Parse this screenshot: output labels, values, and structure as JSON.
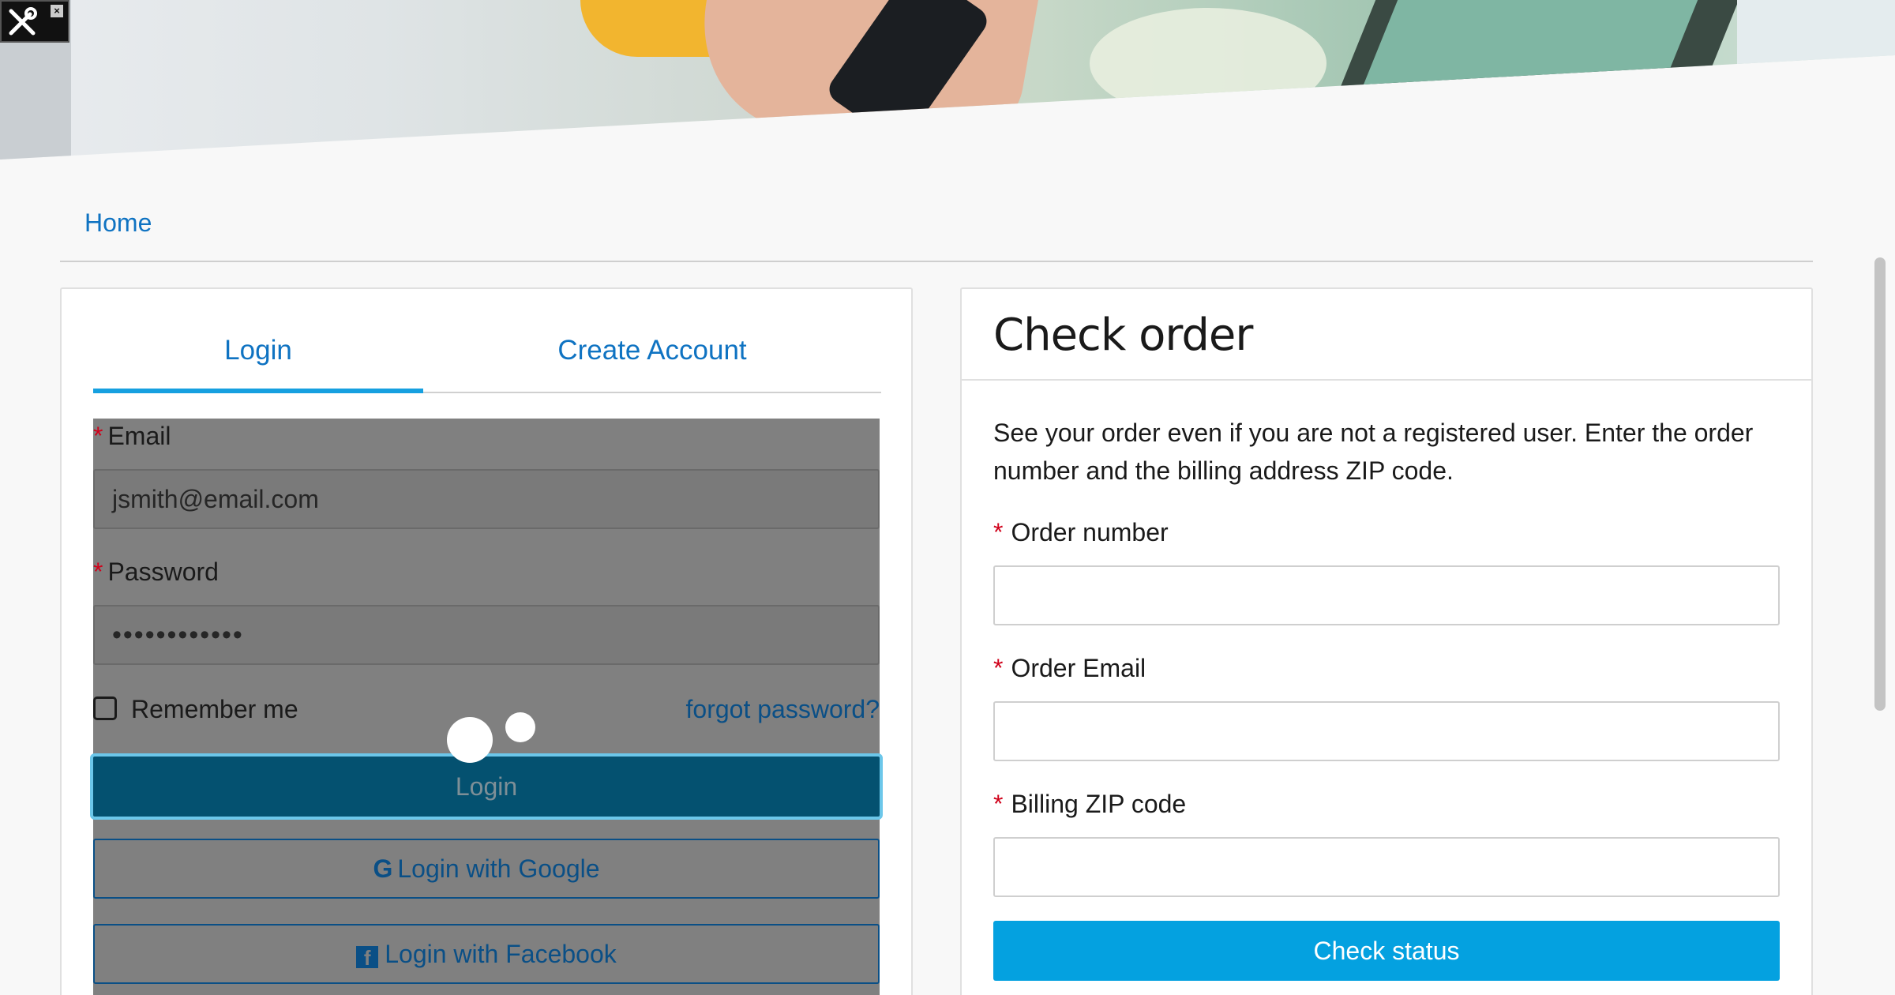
{
  "toolbar_widget": {
    "tools_icon": "tools-icon",
    "close_glyph": "×"
  },
  "breadcrumb": {
    "home": "Home"
  },
  "login_panel": {
    "tabs": {
      "login": "Login",
      "create_account": "Create Account"
    },
    "email": {
      "label": "Email",
      "required_mark": "*",
      "value": "jsmith@email.com"
    },
    "password": {
      "label": "Password",
      "required_mark": "*",
      "value": "••••••••••••"
    },
    "remember_me": "Remember me",
    "forgot_password": "forgot password?",
    "login_button": "Login",
    "google_button": "Login with Google",
    "google_icon_glyph": "G",
    "facebook_button": "Login with Facebook",
    "facebook_icon_glyph": "f"
  },
  "check_order_panel": {
    "title": "Check order",
    "description": "See your order even if you are not a registered user. Enter the order number and the billing address ZIP code.",
    "order_number": {
      "label": "Order number",
      "required_mark": "*",
      "value": ""
    },
    "order_email": {
      "label": "Order Email",
      "required_mark": "*",
      "value": ""
    },
    "billing_zip": {
      "label": "Billing ZIP code",
      "required_mark": "*",
      "value": ""
    },
    "check_button": "Check status"
  },
  "colors": {
    "link": "#0f73c2",
    "tab_underline": "#16a0e0",
    "check_button": "#04a1e0",
    "required": "#d0021b",
    "overlay": "#808080",
    "login_button": "#045170"
  }
}
